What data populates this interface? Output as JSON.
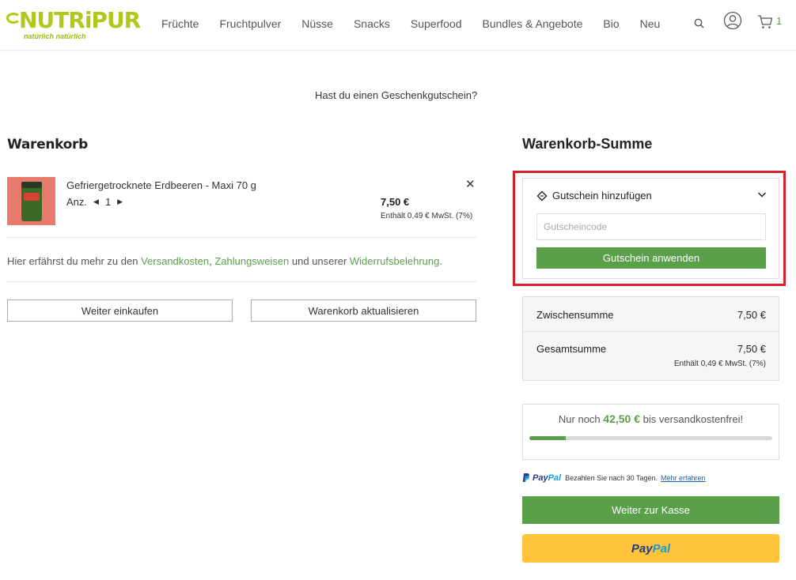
{
  "brand": {
    "name": "NUTRiPUR",
    "tagline": "natürlich natürlich",
    "logo_color": "#b2c818"
  },
  "nav": {
    "items": [
      "Früchte",
      "Fruchtpulver",
      "Nüsse",
      "Snacks",
      "Superfood",
      "Bundles & Angebote",
      "Bio",
      "Neu"
    ]
  },
  "header_icons": {
    "search": "search-icon",
    "account": "user-icon",
    "cart": "cart-icon",
    "cart_count": "1"
  },
  "gift_voucher_prompt": "Hast du einen Geschenkgutschein?",
  "cart": {
    "title": "Warenkorb",
    "item": {
      "name": "Gefriergetrocknete Erdbeeren - Maxi 70 g",
      "qty_label": "Anz.",
      "qty": "1",
      "price": "7,50 €",
      "tax_note": "Enthält 0,49 € MwSt. (7%)"
    },
    "info": {
      "prefix": "Hier erfährst du mehr zu den ",
      "link_shipping": "Versandkosten",
      "sep1": ", ",
      "link_payment": "Zahlungsweisen",
      "mid": " und unserer ",
      "link_withdrawal": "Widerrufsbelehrung",
      "suffix": "."
    },
    "continue_shopping": "Weiter einkaufen",
    "update_cart": "Warenkorb aktualisieren"
  },
  "summary": {
    "title": "Warenkorb-Summe",
    "coupon": {
      "header": "Gutschein hinzufügen",
      "placeholder": "Gutscheincode",
      "button": "Gutschein anwenden"
    },
    "subtotal_label": "Zwischensumme",
    "subtotal_value": "7,50 €",
    "total_label": "Gesamtsumme",
    "total_value": "7,50 €",
    "total_tax_note": "Enthält 0,49 € MwSt. (7%)",
    "free_shipping": {
      "prefix": "Nur noch",
      "amount": "42,50 €",
      "suffix": "bis versandkostenfrei!",
      "progress": 0.15
    },
    "paypal_note": {
      "brand_pay": "Pay",
      "brand_pal": "Pal",
      "text": "Bezahlen Sie nach 30 Tagen.",
      "link": "Mehr erfahren"
    },
    "checkout_button": "Weiter zur Kasse",
    "paypal_button": {
      "pay": "Pay",
      "pal": "Pal"
    }
  },
  "colors": {
    "accent_green": "#5aa04a",
    "highlight_red": "#d8202b",
    "paypal_yellow": "#ffc439",
    "paypal_dark_blue": "#253b80",
    "paypal_light_blue": "#179bd7"
  }
}
